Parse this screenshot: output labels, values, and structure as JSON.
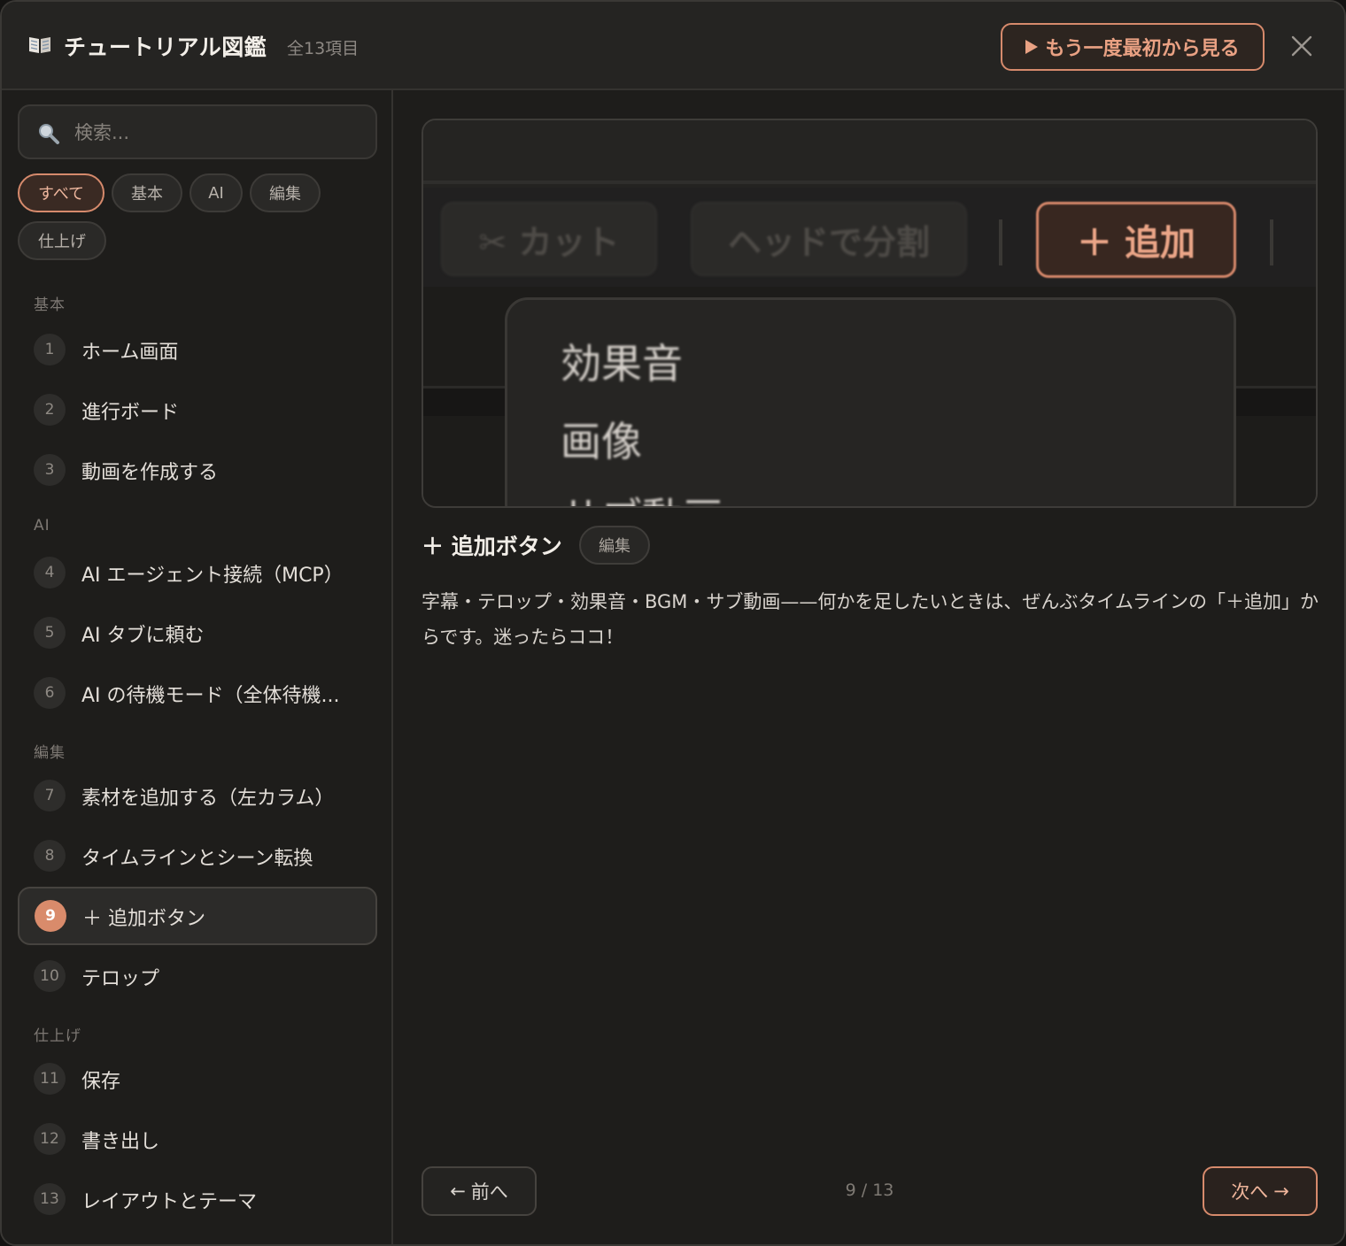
{
  "header": {
    "title": "チュートリアル図鑑",
    "count": "全13項目",
    "replay_label": "もう一度最初から見る"
  },
  "sidebar": {
    "search_placeholder": "検索...",
    "filters": [
      {
        "label": "すべて",
        "active": true
      },
      {
        "label": "基本"
      },
      {
        "label": "AI"
      },
      {
        "label": "編集"
      },
      {
        "label": "仕上げ"
      }
    ],
    "groups": [
      {
        "label": "基本",
        "items": [
          {
            "num": "1",
            "label": "ホーム画面"
          },
          {
            "num": "2",
            "label": "進行ボード"
          },
          {
            "num": "3",
            "label": "動画を作成する"
          }
        ]
      },
      {
        "label": "AI",
        "items": [
          {
            "num": "4",
            "label": "AI エージェント接続（MCP）"
          },
          {
            "num": "5",
            "label": "AI タブに頼む"
          },
          {
            "num": "6",
            "label": "AI の待機モード（全体待機..."
          }
        ]
      },
      {
        "label": "編集",
        "items": [
          {
            "num": "7",
            "label": "素材を追加する（左カラム）"
          },
          {
            "num": "8",
            "label": "タイムラインとシーン転換"
          },
          {
            "num": "9",
            "label": "＋ 追加ボタン",
            "active": true
          },
          {
            "num": "10",
            "label": "テロップ"
          }
        ]
      },
      {
        "label": "仕上げ",
        "items": [
          {
            "num": "11",
            "label": "保存"
          },
          {
            "num": "12",
            "label": "書き出し"
          },
          {
            "num": "13",
            "label": "レイアウトとテーマ"
          }
        ]
      }
    ]
  },
  "preview": {
    "buttons": [
      "✂ カット",
      "ヘッドで分割"
    ],
    "add_button": "＋ 追加",
    "menu_items": [
      "効果音",
      "画像",
      "サブ動画"
    ]
  },
  "detail": {
    "title": "＋ 追加ボタン",
    "tag": "編集",
    "description": "字幕・テロップ・効果音・BGM・サブ動画——何かを足したいときは、ぜんぶタイムラインの「＋追加」からです。迷ったらココ！"
  },
  "nav": {
    "prev_label": "前へ",
    "next_label": "次へ",
    "pager": "9 / 13"
  },
  "colors": {
    "accent": "#d98b6b",
    "background": "#1e1d1b"
  }
}
